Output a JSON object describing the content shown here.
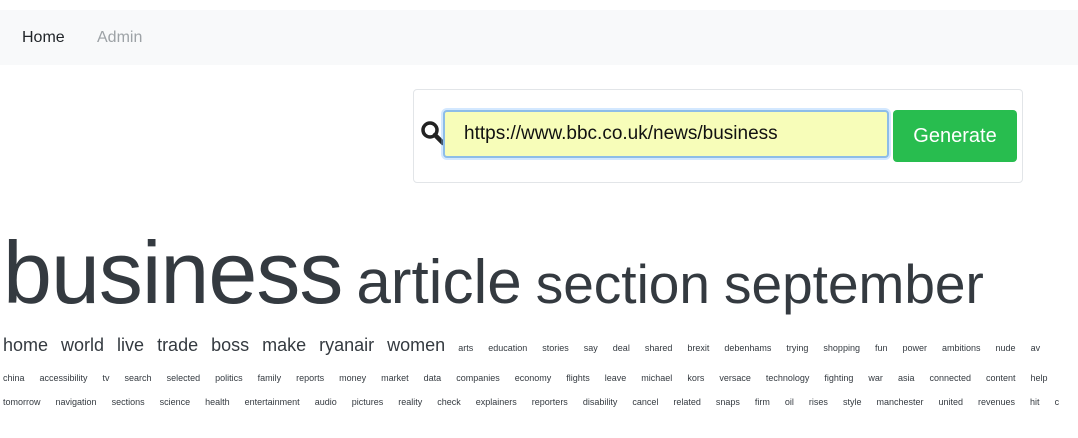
{
  "nav": {
    "home": "Home",
    "admin": "Admin"
  },
  "search": {
    "value": "https://www.bbc.co.uk/news/business",
    "button": "Generate",
    "input_bg": "#f7fdb9",
    "button_color": "#28bd4f"
  },
  "cloud": {
    "row1": [
      "business",
      "article",
      "section",
      "september"
    ],
    "row2_large": [
      "home",
      "world",
      "live",
      "trade",
      "boss",
      "make",
      "ryanair",
      "women"
    ],
    "row2_small": [
      "arts",
      "education",
      "stories",
      "say",
      "deal",
      "shared",
      "brexit",
      "debenhams",
      "trying",
      "shopping",
      "fun",
      "power",
      "ambitions",
      "nude",
      "av"
    ],
    "row3": [
      "china",
      "accessibility",
      "tv",
      "search",
      "selected",
      "politics",
      "family",
      "reports",
      "money",
      "market",
      "data",
      "companies",
      "economy",
      "flights",
      "leave",
      "michael",
      "kors",
      "versace",
      "technology",
      "fighting",
      "war",
      "asia",
      "connected",
      "content",
      "help"
    ],
    "row4": [
      "tomorrow",
      "navigation",
      "sections",
      "science",
      "health",
      "entertainment",
      "audio",
      "pictures",
      "reality",
      "check",
      "explainers",
      "reporters",
      "disability",
      "cancel",
      "related",
      "snaps",
      "firm",
      "oil",
      "rises",
      "style",
      "manchester",
      "united",
      "revenues",
      "hit",
      "c"
    ]
  }
}
